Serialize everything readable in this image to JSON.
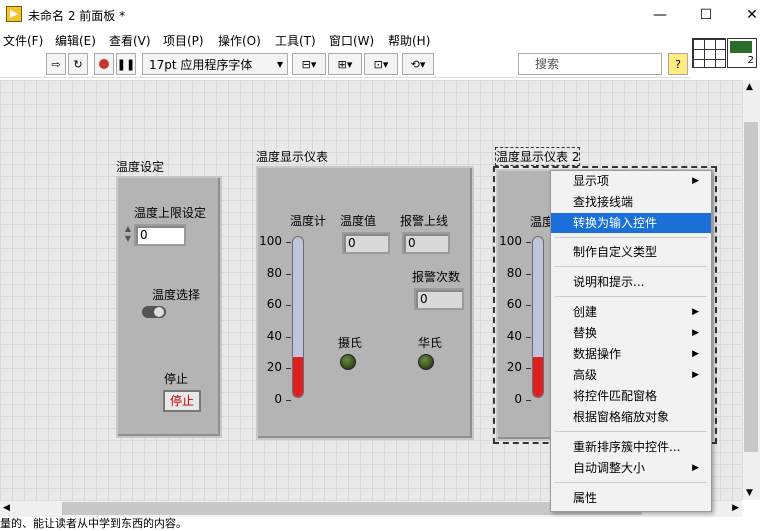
{
  "window": {
    "title": "未命名 2 前面板 *",
    "minimize": "—",
    "maximize": "☐",
    "close": "✕"
  },
  "menu": [
    "文件(F)",
    "编辑(E)",
    "查看(V)",
    "项目(P)",
    "操作(O)",
    "工具(T)",
    "窗口(W)",
    "帮助(H)"
  ],
  "toolbar": {
    "font": "17pt 应用程序字体",
    "search_placeholder": "搜索",
    "help": "?",
    "vi_icon_number": "2"
  },
  "controls": {
    "temp_setting": {
      "label": "温度设定",
      "upper_limit_label": "温度上限设定",
      "upper_limit_value": "0",
      "switch_label": "温度选择",
      "stop_label": "停止",
      "stop_button": "停止"
    },
    "gauge1": {
      "label": "温度显示仪表",
      "thermo_label": "温度计",
      "value_label": "温度值",
      "value": "0",
      "alarm_limit_label": "报警上线",
      "alarm_limit": "0",
      "alarm_count_label": "报警次数",
      "alarm_count": "0",
      "celsius": "摄氏",
      "fahrenheit": "华氏",
      "ticks": [
        "100",
        "80",
        "60",
        "40",
        "20",
        "0"
      ],
      "fill_fraction": 0.25
    },
    "gauge2": {
      "label": "温度显示仪表 2",
      "thermo_label": "温度",
      "ticks": [
        "100",
        "80",
        "60",
        "40",
        "20",
        "0"
      ],
      "fill_fraction": 0.25
    }
  },
  "context_menu": {
    "items": [
      {
        "label": "显示项",
        "arrow": "▶"
      },
      {
        "label": "查找接线端"
      },
      {
        "label": "转换为输入控件",
        "highlighted": true
      },
      {
        "label": "制作自定义类型"
      },
      {
        "label": "说明和提示..."
      },
      {
        "label": "创建",
        "arrow": "▶"
      },
      {
        "label": "替换",
        "arrow": "▶"
      },
      {
        "label": "数据操作",
        "arrow": "▶"
      },
      {
        "label": "高级",
        "arrow": "▶"
      },
      {
        "label": "将控件匹配窗格"
      },
      {
        "label": "根据窗格缩放对象"
      },
      {
        "label": "重新排序簇中控件..."
      },
      {
        "label": "自动调整大小",
        "arrow": "▶"
      },
      {
        "label": "属性"
      }
    ]
  },
  "status": "量的、能让读者从中学到东西的内容。"
}
